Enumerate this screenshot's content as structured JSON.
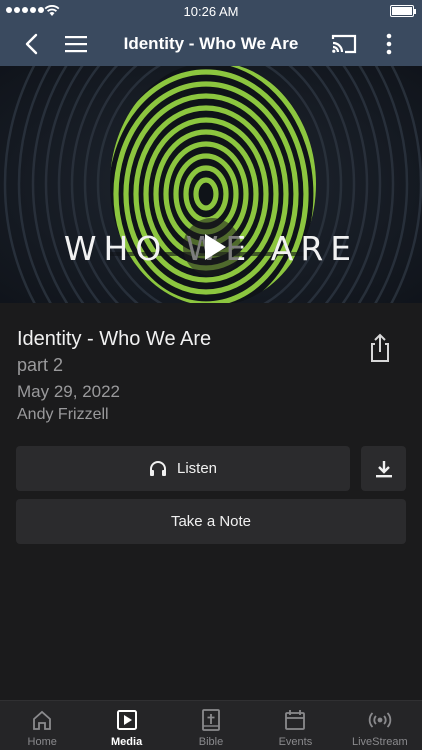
{
  "status_bar": {
    "time": "10:26 AM"
  },
  "nav": {
    "title": "Identity - Who We Are"
  },
  "hero": {
    "overlay_text": "WHO WE ARE"
  },
  "episode": {
    "title": "Identity - Who We Are",
    "part": "part 2",
    "date": "May 29, 2022",
    "speaker": "Andy Frizzell"
  },
  "actions": {
    "listen_label": "Listen",
    "note_label": "Take a Note"
  },
  "tab_bar": {
    "active": "Media",
    "tabs": [
      {
        "label": "Home",
        "icon": "home-icon"
      },
      {
        "label": "Media",
        "icon": "media-icon"
      },
      {
        "label": "Bible",
        "icon": "bible-icon"
      },
      {
        "label": "Events",
        "icon": "calendar-icon"
      },
      {
        "label": "LiveStream",
        "icon": "broadcast-icon"
      }
    ]
  },
  "colors": {
    "nav_bg": "#3a4a5f",
    "page_bg": "#1b1b1c",
    "button_bg": "#2b2b2d",
    "accent_green": "#8cc63f"
  }
}
